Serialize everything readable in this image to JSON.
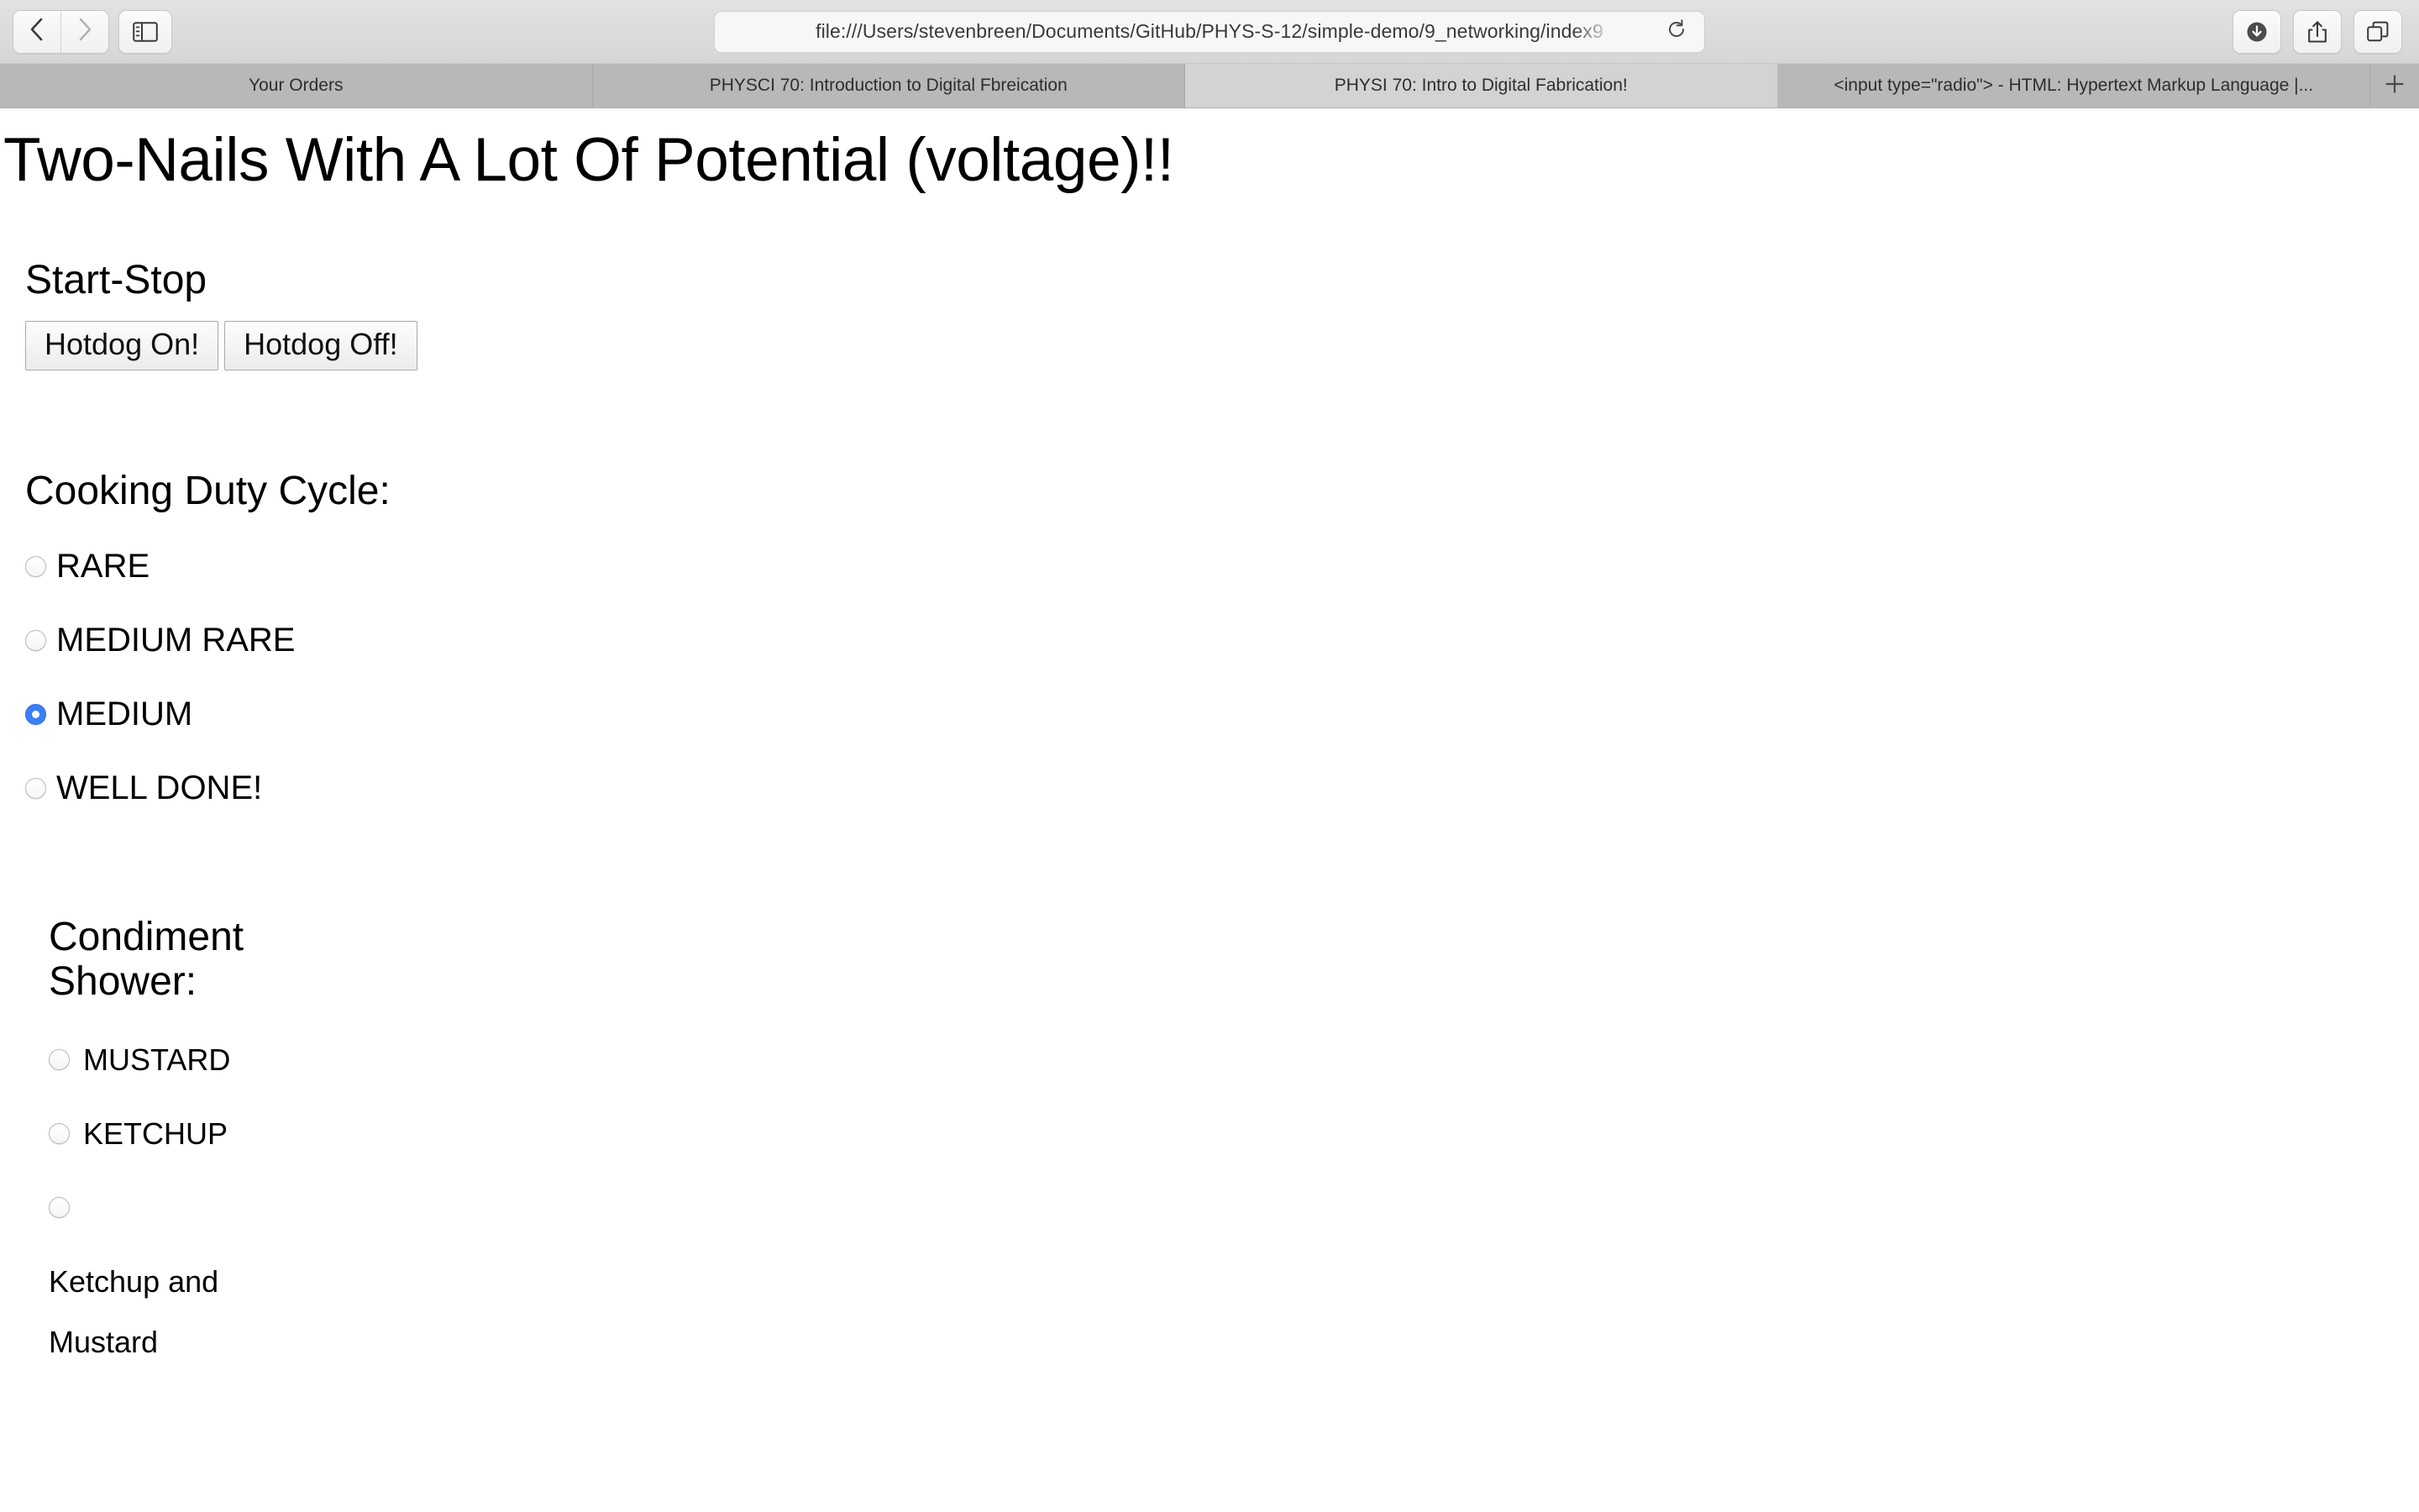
{
  "browser": {
    "nav": {
      "back_label": "Back",
      "forward_label": "Forward",
      "sidebar_label": "Show Sidebar"
    },
    "url": "file:///Users/stevenbreen/Documents/GitHub/PHYS-S-12/simple-demo/9_networking/index9",
    "reload_label": "Reload",
    "actions": {
      "downloads_label": "Downloads",
      "share_label": "Share",
      "tab_overview_label": "Tab Overview"
    },
    "tabs": [
      {
        "title": "Your Orders",
        "active": false
      },
      {
        "title": "PHYSCI 70: Introduction to Digital Fbreication",
        "active": false
      },
      {
        "title": "PHYSI 70: Intro to Digital Fabrication!",
        "active": true
      },
      {
        "title": "<input type=\"radio\"> - HTML: Hypertext Markup Language |...",
        "active": false
      }
    ],
    "new_tab_label": "+"
  },
  "page": {
    "title": "Two-Nails With A Lot Of Potential (voltage)!!",
    "start_stop": {
      "heading": "Start-Stop",
      "buttons": [
        {
          "label": "Hotdog On!"
        },
        {
          "label": "Hotdog Off!"
        }
      ]
    },
    "duty_cycle": {
      "heading": "Cooking Duty Cycle:",
      "options": [
        {
          "label": "RARE",
          "checked": false
        },
        {
          "label": "MEDIUM RARE",
          "checked": false
        },
        {
          "label": "MEDIUM",
          "checked": true
        },
        {
          "label": "WELL DONE!",
          "checked": false
        }
      ]
    },
    "condiment": {
      "heading_line1": "Condiment",
      "heading_line2": "Shower:",
      "options": [
        {
          "label": "MUSTARD",
          "checked": false
        },
        {
          "label": "KETCHUP",
          "checked": false
        }
      ],
      "third_option": {
        "checked": false,
        "label_line1": "Ketchup and",
        "label_line2": "Mustard"
      }
    }
  },
  "colors": {
    "accent_blue": "#3b7ff5",
    "chrome_gray": "#dcdcdc",
    "tab_inactive": "#b8b8b8",
    "tab_active": "#d3d3d3"
  }
}
